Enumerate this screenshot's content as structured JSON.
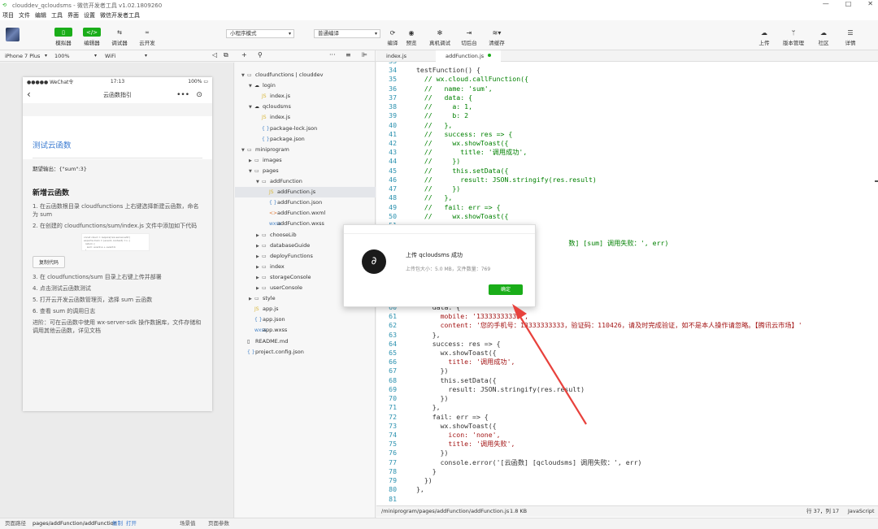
{
  "window": {
    "title": "clouddev_qcloudsms - 微信开发者工具 v1.02.1809260",
    "controls": [
      "—",
      "□",
      "✕"
    ]
  },
  "menu": [
    "项目",
    "文件",
    "编辑",
    "工具",
    "界面",
    "设置",
    "微信开发者工具"
  ],
  "toolbar": {
    "simulator": "模拟器",
    "editor": "编辑器",
    "debugger": "调试器",
    "cloud": "云开发",
    "mode_select": "小程序模式",
    "compile_select": "普通编译",
    "compile": "编译",
    "preview": "预览",
    "real_debug": "真机调试",
    "backend": "切后台",
    "clear_cache": "清缓存",
    "upload": "上传",
    "version": "版本管理",
    "community": "社区",
    "details": "详情"
  },
  "subbar": {
    "device": "iPhone 7 Plus",
    "zoom": "100%",
    "network": "WiFi"
  },
  "phone": {
    "carrier": "●●●●● WeChat令",
    "time": "17:13",
    "battery": "100% ▭",
    "nav_title": "云函数指引",
    "card_title": "测试云函数",
    "expect": "期望输出：{\"sum\":3}",
    "section_title": "新增云函数",
    "steps": [
      "1. 在云函数根目录 cloudfunctions 上右键选择新建云函数，命名为 sum",
      "2. 在创建的 cloudfunctions/sum/index.js 文件中添加如下代码",
      "3. 在 cloudfunctions/sum 目录上右键上传并部署",
      "4. 点击测试云函数测试",
      "5. 打开云开发云函数管理页，选择 sum 云函数",
      "6. 查看 sum 的调用日志",
      "进阶：可在云函数中使用 wx-server-sdk 操作数据库，文件存储和调用其他云函数，详见文档"
    ],
    "copy_button": "复制代码",
    "code_snippet": "const cloud = require('wx-server-sdk')\nexports.main = (event, context) => {\n  return {\n    sum: event.a + event.b\n  }\n}"
  },
  "tree": [
    {
      "label": "cloudfunctions | clouddev",
      "depth": 0,
      "type": "fold",
      "open": true
    },
    {
      "label": "login",
      "depth": 1,
      "type": "cloud",
      "open": true
    },
    {
      "label": "index.js",
      "depth": 2,
      "type": "js"
    },
    {
      "label": "qcloudsms",
      "depth": 1,
      "type": "cloud",
      "open": true
    },
    {
      "label": "index.js",
      "depth": 2,
      "type": "js"
    },
    {
      "label": "package-lock.json",
      "depth": 2,
      "type": "json"
    },
    {
      "label": "package.json",
      "depth": 2,
      "type": "json"
    },
    {
      "label": "miniprogram",
      "depth": 0,
      "type": "fold",
      "open": true
    },
    {
      "label": "images",
      "depth": 1,
      "type": "fold",
      "open": false
    },
    {
      "label": "pages",
      "depth": 1,
      "type": "fold",
      "open": true
    },
    {
      "label": "addFunction",
      "depth": 2,
      "type": "fold",
      "open": true
    },
    {
      "label": "addFunction.js",
      "depth": 3,
      "type": "js",
      "selected": true
    },
    {
      "label": "addFunction.json",
      "depth": 3,
      "type": "json"
    },
    {
      "label": "addFunction.wxml",
      "depth": 3,
      "type": "wxml"
    },
    {
      "label": "addFunction.wxss",
      "depth": 3,
      "type": "wxss"
    },
    {
      "label": "chooseLib",
      "depth": 2,
      "type": "fold",
      "open": false
    },
    {
      "label": "databaseGuide",
      "depth": 2,
      "type": "fold",
      "open": false
    },
    {
      "label": "deployFunctions",
      "depth": 2,
      "type": "fold",
      "open": false
    },
    {
      "label": "index",
      "depth": 2,
      "type": "fold",
      "open": false
    },
    {
      "label": "storageConsole",
      "depth": 2,
      "type": "fold",
      "open": false
    },
    {
      "label": "userConsole",
      "depth": 2,
      "type": "fold",
      "open": false
    },
    {
      "label": "style",
      "depth": 1,
      "type": "fold",
      "open": false
    },
    {
      "label": "app.js",
      "depth": 1,
      "type": "js"
    },
    {
      "label": "app.json",
      "depth": 1,
      "type": "json"
    },
    {
      "label": "app.wxss",
      "depth": 1,
      "type": "wxss"
    },
    {
      "label": "README.md",
      "depth": 0,
      "type": "md"
    },
    {
      "label": "project.config.json",
      "depth": 0,
      "type": "json"
    }
  ],
  "icons": {
    "fold": "▭",
    "cloud": "☁",
    "js": "JS",
    "json": "{ }",
    "wxml": "<>",
    "wxss": "wxss",
    "md": "▯"
  },
  "tabs": [
    "index.js",
    "addFunction.js"
  ],
  "code_lines": [
    {
      "n": "33",
      "t": ""
    },
    {
      "n": "34",
      "t": "testFunction() {"
    },
    {
      "n": "35",
      "t": "  // wx.cloud.callFunction({",
      "c": "cm"
    },
    {
      "n": "36",
      "t": "  //   name: 'sum',",
      "c": "cm"
    },
    {
      "n": "37",
      "t": "  //   data: {",
      "c": "cm"
    },
    {
      "n": "38",
      "t": "  //     a: 1,",
      "c": "cm"
    },
    {
      "n": "39",
      "t": "  //     b: 2",
      "c": "cm"
    },
    {
      "n": "40",
      "t": "  //   },",
      "c": "cm"
    },
    {
      "n": "41",
      "t": "  //   success: res => {",
      "c": "cm"
    },
    {
      "n": "42",
      "t": "  //     wx.showToast({",
      "c": "cm"
    },
    {
      "n": "43",
      "t": "  //       title: '调用成功',",
      "c": "cm"
    },
    {
      "n": "44",
      "t": "  //     })",
      "c": "cm"
    },
    {
      "n": "45",
      "t": "  //     this.setData({",
      "c": "cm"
    },
    {
      "n": "46",
      "t": "  //       result: JSON.stringify(res.result)",
      "c": "cm"
    },
    {
      "n": "47",
      "t": "  //     })",
      "c": "cm"
    },
    {
      "n": "48",
      "t": "  //   },",
      "c": "cm"
    },
    {
      "n": "49",
      "t": "  //   fail: err => {",
      "c": "cm"
    },
    {
      "n": "50",
      "t": "  //     wx.showToast({",
      "c": "cm"
    },
    {
      "n": "51",
      "t": ""
    },
    {
      "n": "52",
      "t": ""
    },
    {
      "n": "53",
      "t": "                                      数] [sum] 调用失败：', err)",
      "c": "cm"
    },
    {
      "n": "54",
      "t": ""
    },
    {
      "n": "55",
      "t": ""
    },
    {
      "n": "56",
      "t": ""
    },
    {
      "n": "57",
      "t": ""
    },
    {
      "n": "58",
      "t": ""
    },
    {
      "n": "59",
      "t": ""
    },
    {
      "n": "60",
      "t": "    data: {"
    },
    {
      "n": "61",
      "t": "      mobile: '13333333333',",
      "c": "st"
    },
    {
      "n": "62",
      "t": "      content: '您的手机号：13333333333，验证码：110426，请及时完成验证，如不是本人操作请忽略。【腾讯云市场】'",
      "c": "st"
    },
    {
      "n": "63",
      "t": "    },"
    },
    {
      "n": "64",
      "t": "    success: res => {"
    },
    {
      "n": "65",
      "t": "      wx.showToast({"
    },
    {
      "n": "66",
      "t": "        title: '调用成功',",
      "c": "st"
    },
    {
      "n": "67",
      "t": "      })"
    },
    {
      "n": "68",
      "t": "      this.setData({"
    },
    {
      "n": "69",
      "t": "        result: JSON.stringify(res.result)"
    },
    {
      "n": "70",
      "t": "      })"
    },
    {
      "n": "71",
      "t": "    },"
    },
    {
      "n": "72",
      "t": "    fail: err => {"
    },
    {
      "n": "73",
      "t": "      wx.showToast({"
    },
    {
      "n": "74",
      "t": "        icon: 'none',",
      "c": "st"
    },
    {
      "n": "75",
      "t": "        title: '调用失败',",
      "c": "st"
    },
    {
      "n": "76",
      "t": "      })"
    },
    {
      "n": "77",
      "t": "      console.error('[云函数] [qcloudsms] 调用失败：', err)"
    },
    {
      "n": "78",
      "t": "    }"
    },
    {
      "n": "79",
      "t": "  })"
    },
    {
      "n": "80",
      "t": "},"
    },
    {
      "n": "81",
      "t": ""
    }
  ],
  "statusbar": {
    "path": "/miniprogram/pages/addFunction/addFunction.js",
    "size": "1.8 KB",
    "position": "行 37，列 17",
    "language": "JavaScript"
  },
  "bottombar": {
    "label": "页面路径",
    "page": "pages/addFunction/addFunction",
    "copy": "复制",
    "open": "打开",
    "scene": "场景值",
    "params": "页面参数"
  },
  "modal": {
    "title": "上传 qcloudsms 成功",
    "subtitle": "上传包大小：5.0 MB，文件数量：769",
    "confirm": "确定"
  },
  "colors": {
    "brand_green": "#1aad19",
    "arrow_red": "#e8413c"
  }
}
